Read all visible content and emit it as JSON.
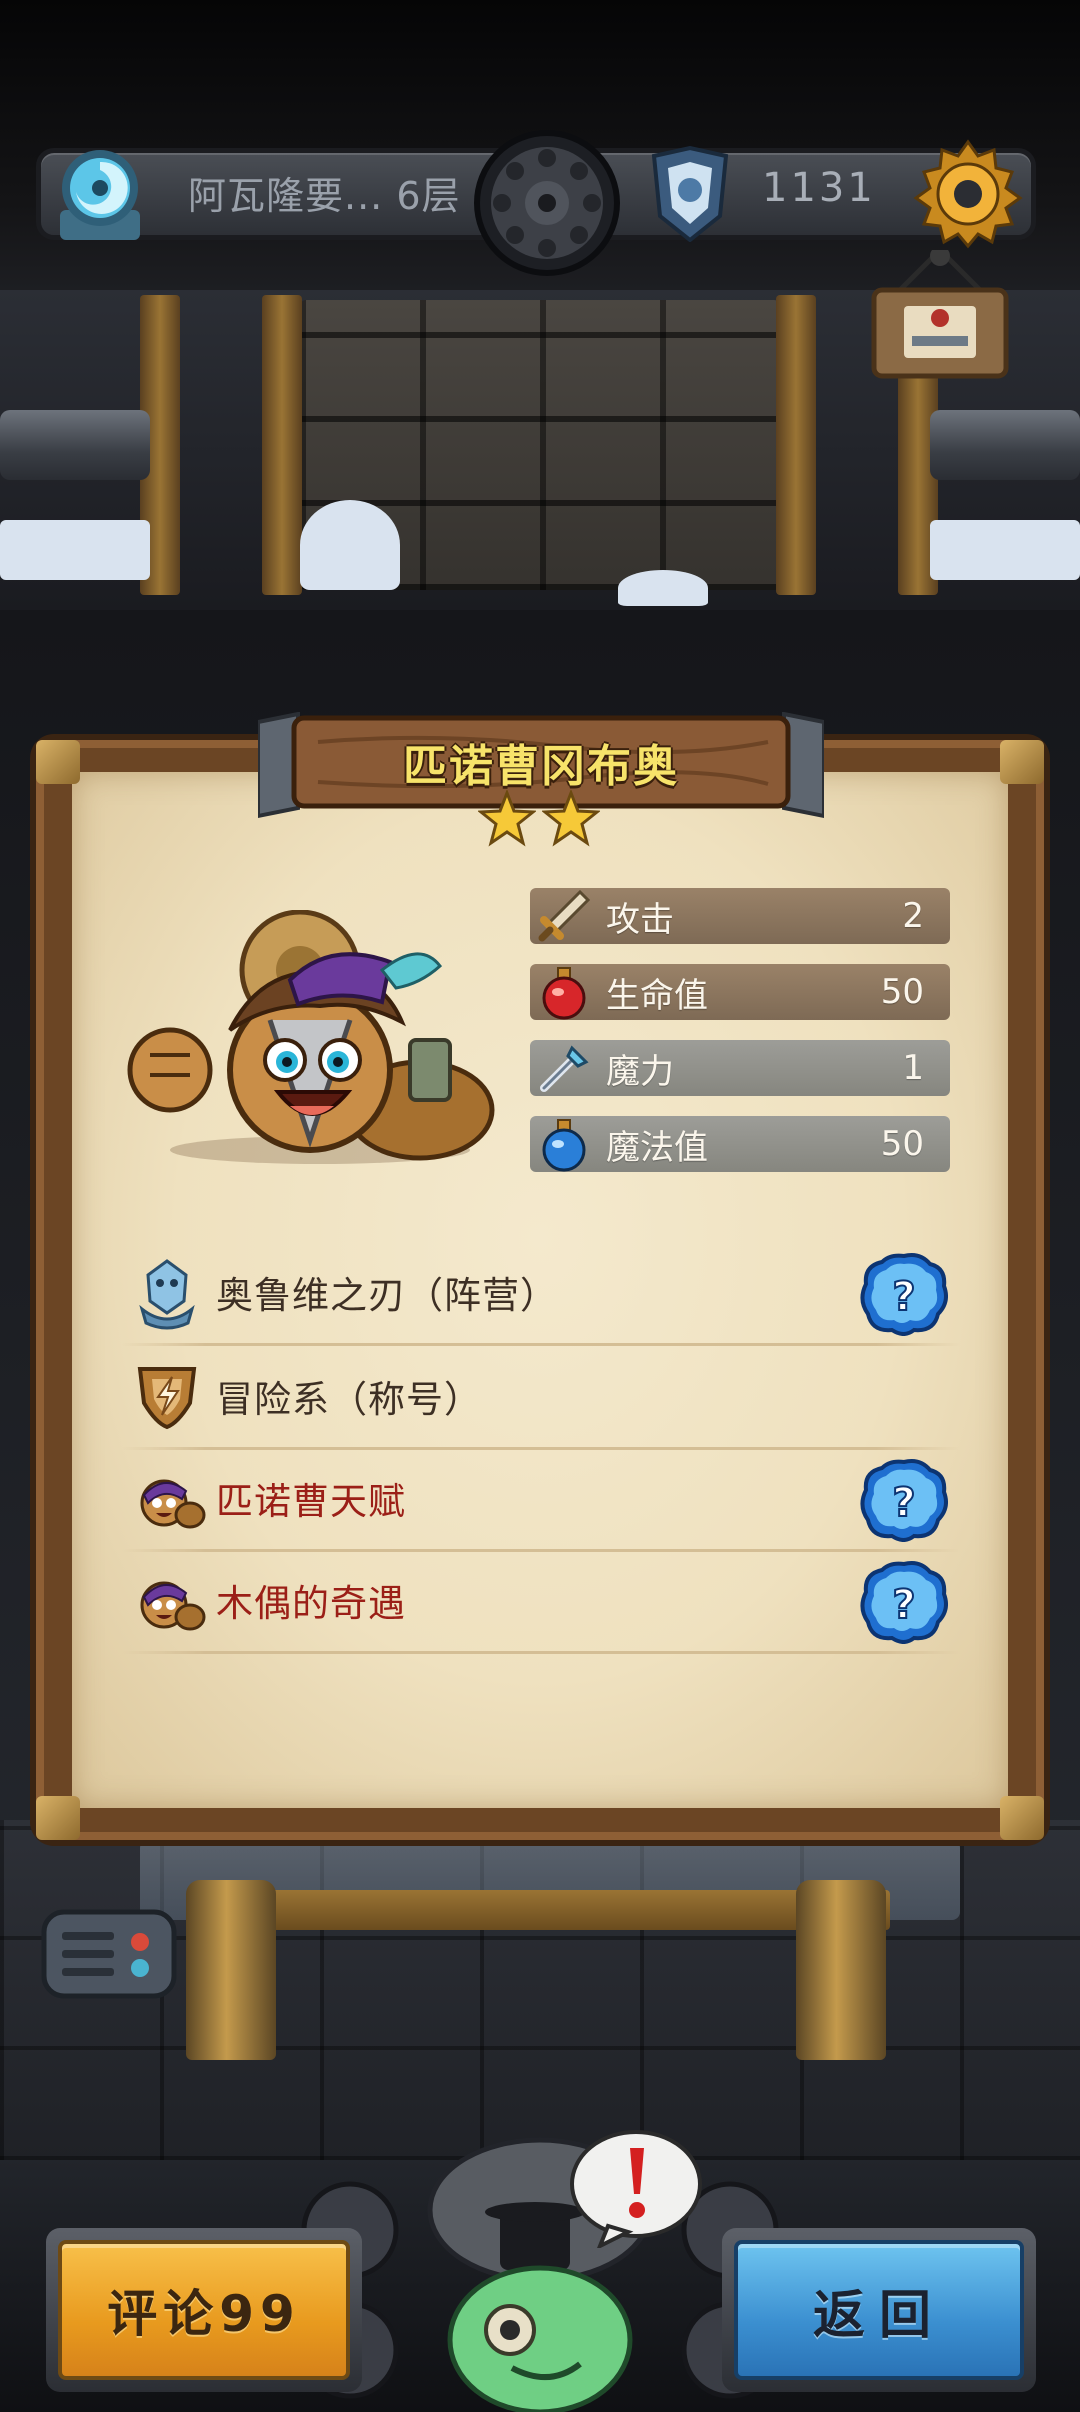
{
  "topbar": {
    "floor_label": "阿瓦隆要... 6层",
    "score": "1131"
  },
  "hero": {
    "name": "匹诺曹冈布奥",
    "star_count": 2,
    "stats": [
      {
        "icon": "sword-icon",
        "label": "攻击",
        "value": "2"
      },
      {
        "icon": "red-potion-icon",
        "label": "生命值",
        "value": "50"
      },
      {
        "icon": "magic-staff-icon",
        "label": "魔力",
        "value": "1"
      },
      {
        "icon": "blue-potion-icon",
        "label": "魔法值",
        "value": "50"
      }
    ],
    "traits": [
      {
        "icon": "faction-crystal-icon",
        "label": "奥鲁维之刃（阵营）",
        "color": "#3d2f24",
        "has_help": true
      },
      {
        "icon": "title-shield-icon",
        "label": "冒险系（称号）",
        "color": "#3d2f24",
        "has_help": false
      },
      {
        "icon": "hero-talent-icon",
        "label": "匹诺曹天赋",
        "color": "#9b1f17",
        "has_help": true
      },
      {
        "icon": "hero-talent-icon",
        "label": "木偶的奇遇",
        "color": "#9b1f17",
        "has_help": true
      }
    ]
  },
  "buttons": {
    "comment_label": "评论99",
    "back_label": "返回"
  },
  "colors": {
    "comment_button": "#f0a830",
    "back_button": "#4aa0dc",
    "title_text": "#f7e36a",
    "special_text": "#9b1f17"
  }
}
